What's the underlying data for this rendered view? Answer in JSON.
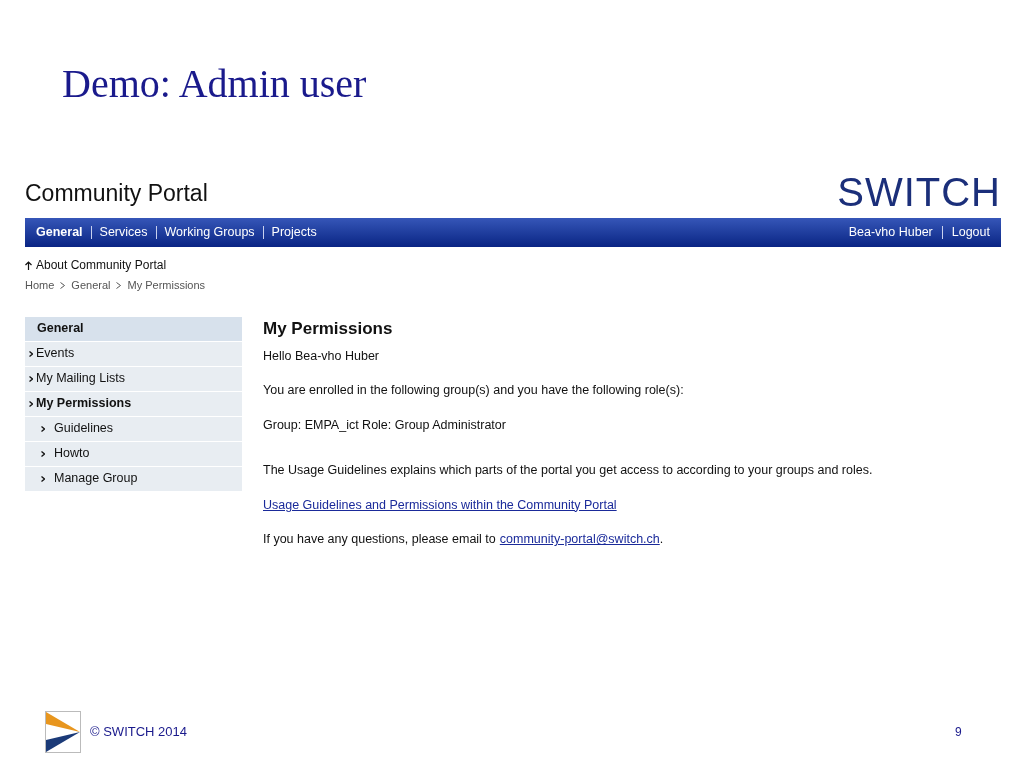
{
  "slide": {
    "title": "Demo: Admin user",
    "footer": "© SWITCH 2014",
    "page_number": "9"
  },
  "portal": {
    "title": "Community Portal",
    "logo": "SWITCH",
    "nav": [
      {
        "label": "General",
        "selected": true
      },
      {
        "label": "Services",
        "selected": false
      },
      {
        "label": "Working Groups",
        "selected": false
      },
      {
        "label": "Projects",
        "selected": false
      }
    ],
    "user_nav": [
      "Bea-vho Huber",
      "Logout"
    ],
    "up_link": "About Community Portal",
    "breadcrumb": [
      "Home",
      "General",
      "My Permissions"
    ],
    "sidebar": {
      "title": "General",
      "items": [
        {
          "label": "Events",
          "selected": false
        },
        {
          "label": "My Mailing Lists",
          "selected": false
        },
        {
          "label": "My Permissions",
          "selected": true,
          "children": [
            {
              "label": "Guidelines",
              "selected": false
            },
            {
              "label": "Howto",
              "selected": false
            },
            {
              "label": "Manage Group",
              "selected": false
            }
          ]
        }
      ]
    },
    "content": {
      "heading": "My Permissions",
      "paragraphs": [
        {
          "kind": "text",
          "text": "Hello Bea-vho Huber"
        },
        {
          "kind": "text",
          "text": "You are enrolled in the following group(s) and you have the following role(s):"
        },
        {
          "kind": "text",
          "text": "Group: EMPA_ict Role: Group Administrator"
        },
        {
          "kind": "text",
          "text": "The Usage Guidelines explains which parts of the portal you get access to according to your groups and roles."
        },
        {
          "kind": "link",
          "text": "Usage Guidelines and Permissions within the Community Portal"
        },
        {
          "kind": "mixed",
          "text": "If you have any questions, please email to",
          "link": "community-portal@switch.ch",
          "after": "."
        }
      ]
    }
  }
}
